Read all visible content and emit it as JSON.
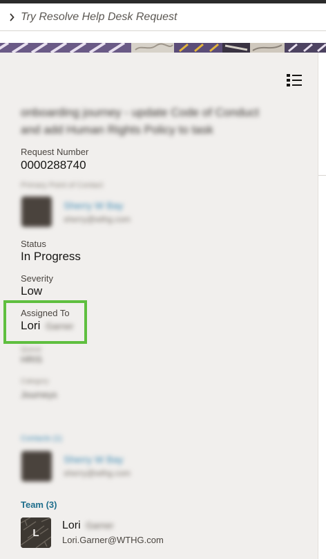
{
  "breadcrumb": {
    "text": "Try Resolve Help Desk Request"
  },
  "request": {
    "title_line_1": "onboarding journey - update Code of Conduct",
    "title_line_2": "and add Human Rights Policy to task",
    "request_number_label": "Request Number",
    "request_number": "0000288740",
    "primary_contact_label": "Primary Point of Contact",
    "primary_contact_name": "Sherry W Bay",
    "primary_contact_email": "sherry@wthg.com",
    "status_label": "Status",
    "status": "In Progress",
    "severity_label": "Severity",
    "severity": "Low",
    "assigned_to_label": "Assigned To",
    "assigned_to_first": "Lori",
    "assigned_to_last": "Garner",
    "blurred_field_1_label": "Queue",
    "blurred_field_1_value": "HRIS",
    "blurred_field_2_label": "Category",
    "blurred_field_2_value": "Journeys",
    "contacts_label": "Contacts (1)",
    "contact_name": "Sherry W Bay",
    "contact_email": "sherry@wthg.com"
  },
  "team": {
    "heading": "Team (3)",
    "member_initial": "L",
    "member_first": "Lori",
    "member_last": "Garner",
    "member_email": "Lori.Garner@WTHG.com"
  },
  "colors": {
    "panel_bg": "#f1efed",
    "link_blue": "#1f6e8c",
    "highlight_green": "#5fbf3f"
  }
}
